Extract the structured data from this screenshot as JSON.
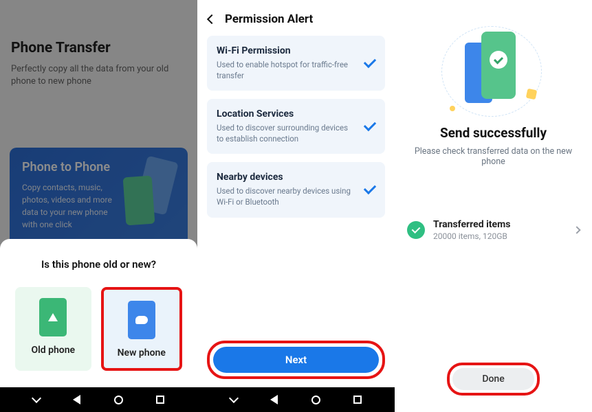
{
  "screen1": {
    "title": "Phone Transfer",
    "subtitle": "Perfectly copy all the data from your old phone to new phone",
    "card": {
      "title": "Phone to Phone",
      "desc": "Copy contacts, music, photos, videos and more data to your new phone with one click"
    },
    "question": "Is this phone old or new?",
    "old_label": "Old phone",
    "new_label": "New phone"
  },
  "screen2": {
    "title": "Permission Alert",
    "perms": [
      {
        "title": "Wi-Fi Permission",
        "desc": "Used to enable hotspot for traffic-free transfer"
      },
      {
        "title": "Location Services",
        "desc": "Used to discover surrounding devices to establish connection"
      },
      {
        "title": "Nearby devices",
        "desc": "Used to discover nearby devices using Wi-Fi or Bluetooth"
      }
    ],
    "next_label": "Next"
  },
  "screen3": {
    "title": "Send successfully",
    "subtitle": "Please check transferred data on the new phone",
    "item_title": "Transferred items",
    "item_sub": "20000 items, 120GB",
    "done_label": "Done"
  }
}
